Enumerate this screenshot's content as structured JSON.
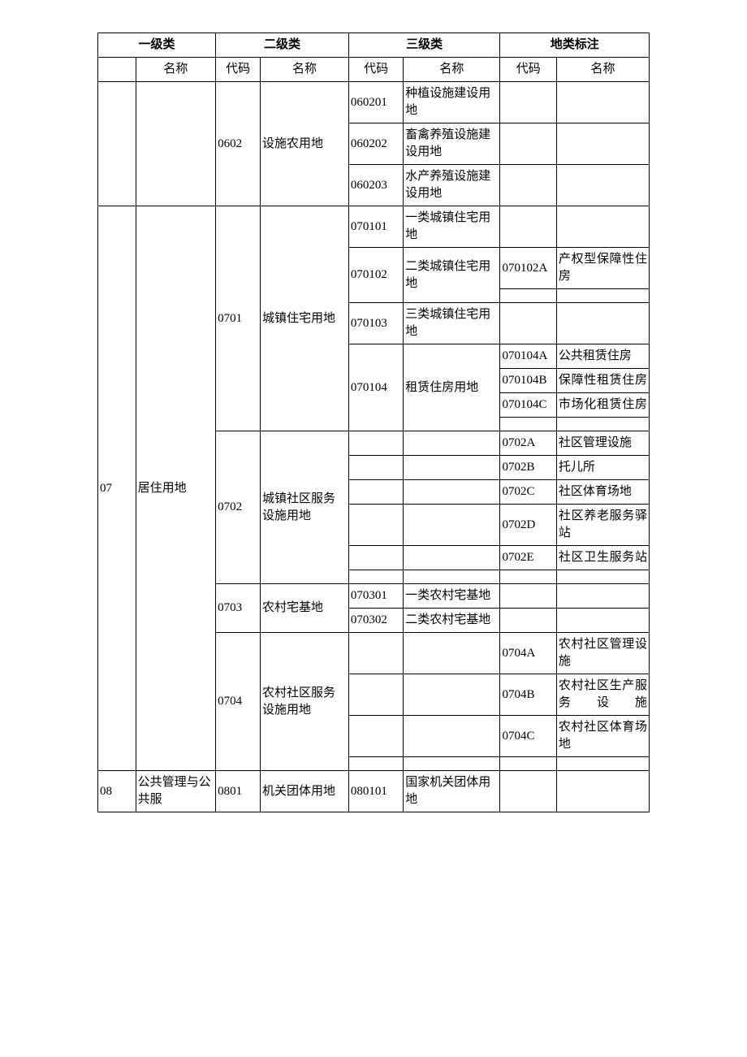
{
  "headers": {
    "lvl1": "一级类",
    "lvl2": "二级类",
    "lvl3": "三级类",
    "lvl4": "地类标注",
    "name": "名称",
    "code": "代码"
  },
  "r06": {
    "c0602": "0602",
    "n0602": "设施农用地",
    "c060201": "060201",
    "n060201": "种植设施建设用地",
    "c060202": "060202",
    "n060202": "畜禽养殖设施建设用地",
    "c060203": "060203",
    "n060203": "水产养殖设施建设用地"
  },
  "r07": {
    "code": "07",
    "name": "居住用地",
    "c0701": "0701",
    "n0701": "城镇住宅用地",
    "c070101": "070101",
    "n070101": "一类城镇住宅用地",
    "c070102": "070102",
    "n070102": "二类城镇住宅用地",
    "c070102A": "070102A",
    "n070102A": "产权型保障性住房",
    "c070103": "070103",
    "n070103": "三类城镇住宅用地",
    "c070104": "070104",
    "n070104": "租赁住房用地",
    "c070104A": "070104A",
    "n070104A": "公共租赁住房",
    "c070104B": "070104B",
    "n070104B": "保障性租赁住房",
    "c070104C": "070104C",
    "n070104C": "市场化租赁住房",
    "c0702": "0702",
    "n0702": "城镇社区服务设施用地",
    "c0702A": "0702A",
    "n0702A": "社区管理设施",
    "c0702B": "0702B",
    "n0702B": "托儿所",
    "c0702C": "0702C",
    "n0702C": "社区体育场地",
    "c0702D": "0702D",
    "n0702D": "社区养老服务驿站",
    "c0702E": "0702E",
    "n0702E": "社区卫生服务站",
    "c0703": "0703",
    "n0703": "农村宅基地",
    "c070301": "070301",
    "n070301": "一类农村宅基地",
    "c070302": "070302",
    "n070302": "二类农村宅基地",
    "c0704": "0704",
    "n0704": "农村社区服务设施用地",
    "c0704A": "0704A",
    "n0704A": "农村社区管理设施",
    "c0704B": "0704B",
    "n0704B": "农村社区生产服务设施",
    "c0704C": "0704C",
    "n0704C": "农村社区体育场地"
  },
  "r08": {
    "code": "08",
    "name": "公共管理与公共服",
    "c0801": "0801",
    "n0801": "机关团体用地",
    "c080101": "080101",
    "n080101": "国家机关团体用地"
  }
}
